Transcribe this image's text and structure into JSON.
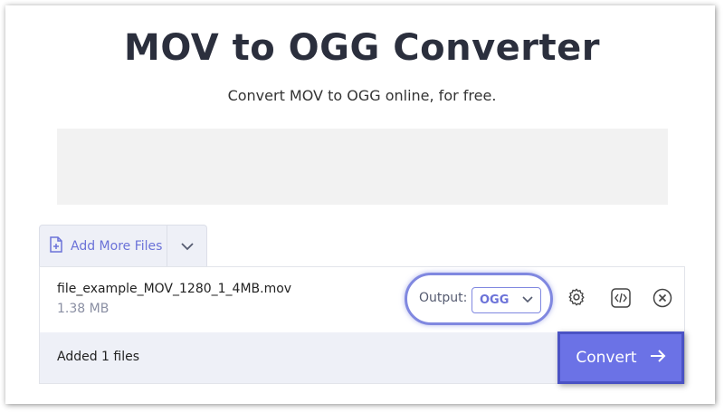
{
  "header": {
    "title": "MOV to OGG Converter",
    "subtitle": "Convert MOV to OGG online, for free."
  },
  "toolbar": {
    "add_more_label": "Add More Files",
    "add_more_icon": "file-plus-icon",
    "dropdown_icon": "chevron-down-icon"
  },
  "file": {
    "name": "file_example_MOV_1280_1_4MB.mov",
    "size": "1.38 MB",
    "output_label": "Output:",
    "output_value": "OGG"
  },
  "actions": {
    "settings_icon": "gear-icon",
    "embed_icon": "code-icon",
    "remove_icon": "close-circle-icon"
  },
  "footer": {
    "added_text": "Added 1 files",
    "convert_label": "Convert"
  },
  "colors": {
    "accent": "#6b72e6",
    "title": "#2b2f3d",
    "panel_bg": "#eef0f7",
    "ad_bg": "#f2f2f2"
  }
}
